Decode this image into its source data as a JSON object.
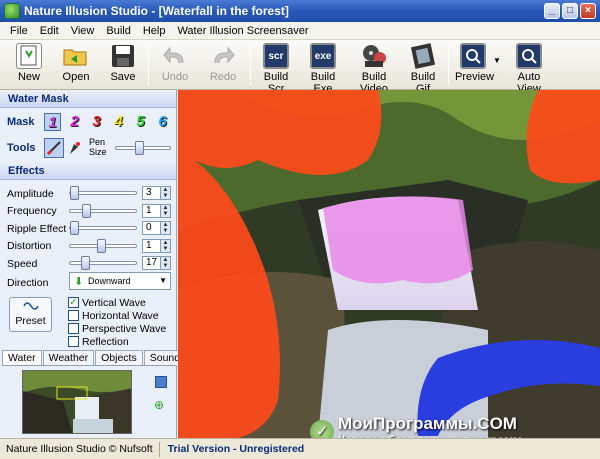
{
  "window": {
    "title": "Nature Illusion Studio - [Waterfall in the forest]"
  },
  "menu": [
    "File",
    "Edit",
    "View",
    "Build",
    "Help",
    "Water Illusion Screensaver"
  ],
  "toolbar": {
    "new": "New",
    "open": "Open",
    "save": "Save",
    "undo": "Undo",
    "redo": "Redo",
    "build_scr": "Build Scr",
    "build_exe": "Build Exe",
    "build_video": "Build Video",
    "build_gif": "Build Gif",
    "preview": "Preview",
    "auto_view": "Auto View",
    "scr_icon_text": "scr",
    "exe_icon_text": "exe"
  },
  "water_mask": {
    "header": "Water Mask",
    "mask_label": "Mask",
    "masks": [
      "1",
      "2",
      "3",
      "4",
      "5",
      "6"
    ],
    "mask_colors": [
      "#c040e0",
      "#e020e0",
      "#e02020",
      "#f0e020",
      "#30d030",
      "#20a0f0"
    ],
    "tools_label": "Tools",
    "pen_size_label": "Pen Size",
    "pen_size_level": 0.4
  },
  "effects": {
    "header": "Effects",
    "params": [
      {
        "label": "Amplitude",
        "value": "3",
        "level": 0.0
      },
      {
        "label": "Frequency",
        "value": "1",
        "level": 0.2
      },
      {
        "label": "Ripple Effect",
        "value": "0",
        "level": 0.0
      },
      {
        "label": "Distortion",
        "value": "1",
        "level": 0.45
      },
      {
        "label": "Speed",
        "value": "17",
        "level": 0.18
      }
    ],
    "direction_label": "Direction",
    "direction_value": "Downward",
    "preset_label": "Preset",
    "checkboxes": [
      {
        "label": "Vertical Wave",
        "checked": true
      },
      {
        "label": "Horizontal Wave",
        "checked": false
      },
      {
        "label": "Perspective Wave",
        "checked": false
      },
      {
        "label": "Reflection",
        "checked": false
      }
    ]
  },
  "tabs": [
    "Water",
    "Weather",
    "Objects",
    "Sound"
  ],
  "status": {
    "left": "Nature Illusion Studio © Nufsoft",
    "right": "Trial Version - Unregistered"
  },
  "watermark": {
    "title": "МоиПрограммы.COM",
    "subtitle": "Каталог бесплатных программ"
  }
}
